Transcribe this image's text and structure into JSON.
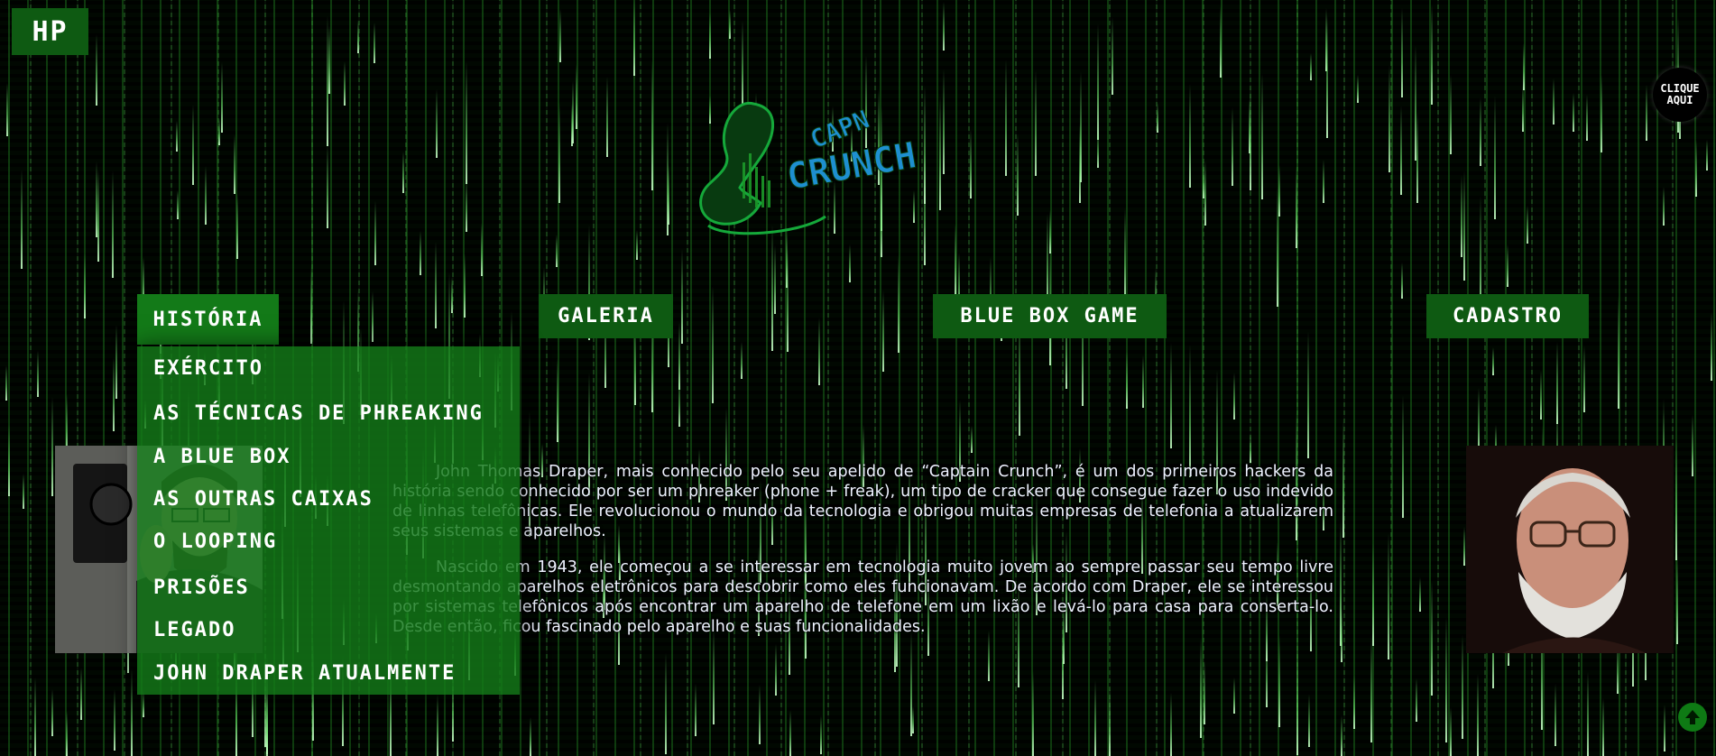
{
  "badge": {
    "text": "HP"
  },
  "cta": {
    "line1": "CLIQUE",
    "line2": "AQUI"
  },
  "logo": {
    "line1": "CAPN",
    "line2": "CRUNCH"
  },
  "nav": {
    "historia": "História",
    "galeria": "Galeria",
    "bluebox_game": "Blue Box Game",
    "cadastro": "Cadastro"
  },
  "dropdown": {
    "items": [
      "Exército",
      "As técnicas de phreaking",
      "A blue box",
      "As outras caixas",
      "O looping",
      "Prisões",
      "Legado",
      "John Draper atualmente"
    ]
  },
  "content": {
    "paragraph1": "John Thomas Draper, mais conhecido pelo seu apelido de “Captain Crunch”, é um dos primeiros hackers da história sendo conhecido por ser um phreaker (phone + freak), um tipo de cracker que consegue fazer o uso indevido de linhas telefônicas. Ele revolucionou o mundo da tecnologia e obrigou muitas empresas de telefonia a atualizarem seus sistemas e aparelhos.",
    "paragraph2": "Nascido em 1943, ele começou a se interessar em tecnologia muito jovem ao sempre passar seu tempo livre desmontando aparelhos eletrônicos para descobrir como eles funcionavam. De acordo com Draper, ele se interessou por sistemas telefônicos após encontrar um aparelho de telefone em um lixão e levá-lo para casa para conserta-lo. Desde então, ficou fascinado pelo aparelho e suas funcionalidades."
  },
  "colors": {
    "nav_bg": "#0e5a12",
    "active_bg": "#137a18",
    "logo_blue": "#1e8fd0",
    "logo_green": "#15a83a"
  },
  "icons": {
    "back_to_top": "arrow-up-icon"
  }
}
